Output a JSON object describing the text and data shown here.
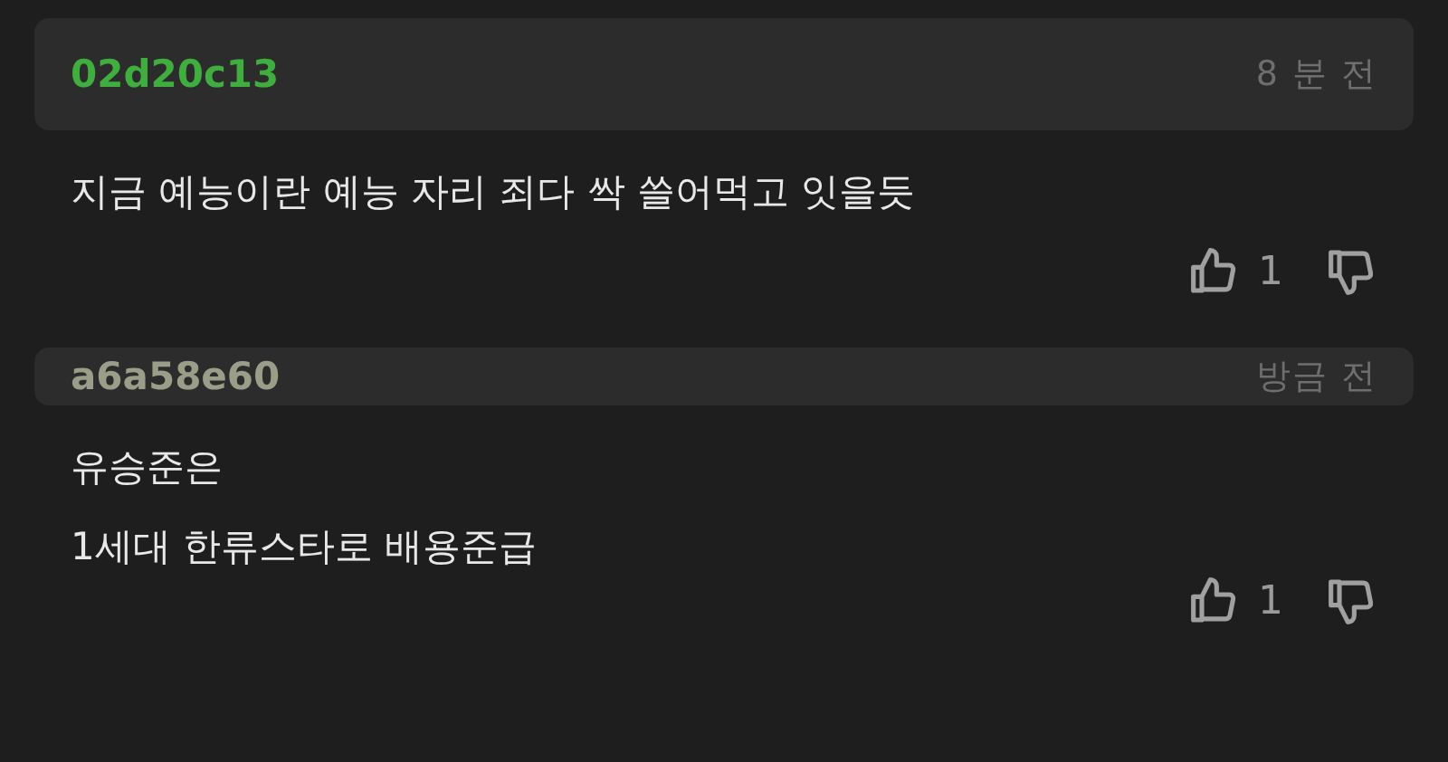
{
  "comments": [
    {
      "author": "02d20c13",
      "color": "#3fae3f",
      "time": "8 분 전",
      "lines": [
        "지금 예능이란 예능 자리 죄다 싹 쓸어먹고 잇을듯"
      ],
      "likes": "1"
    },
    {
      "author": "a6a58e60",
      "color": "#9a9d88",
      "time": "방금 전",
      "lines": [
        "유승준은",
        "1세대 한류스타로 배용준급"
      ],
      "likes": "1"
    }
  ]
}
